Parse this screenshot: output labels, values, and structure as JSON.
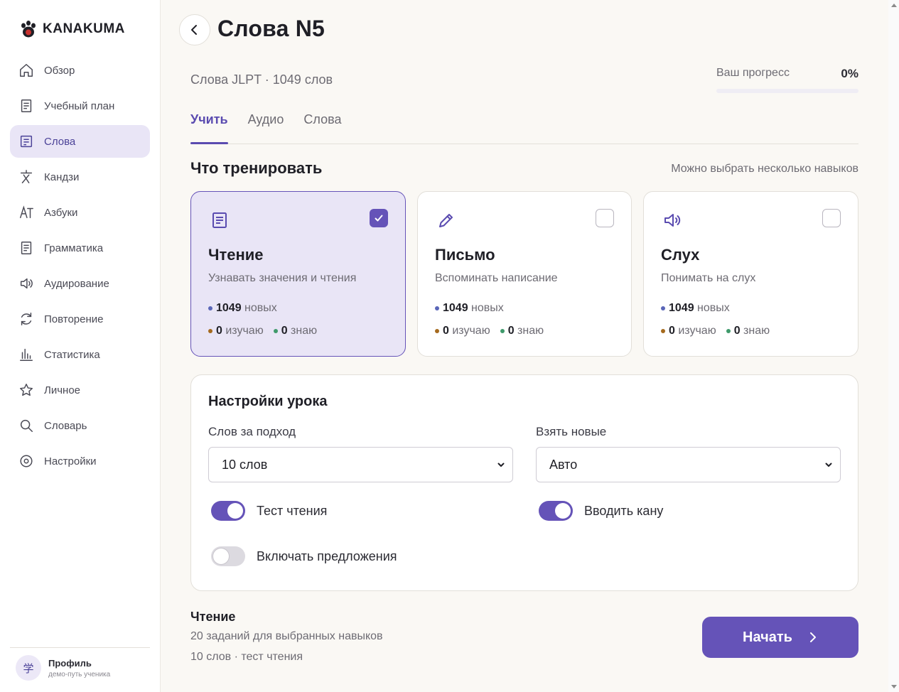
{
  "brand": {
    "name": "KANAKUMA",
    "logo_icon": "paw-icon"
  },
  "sidebar": {
    "items": [
      {
        "label": "Обзор",
        "icon": "home-icon"
      },
      {
        "label": "Учебный план",
        "icon": "document-icon"
      },
      {
        "label": "Слова",
        "icon": "document-icon",
        "active": true
      },
      {
        "label": "Кандзи",
        "icon": "kanji-icon"
      },
      {
        "label": "Азбуки",
        "icon": "kana-icon"
      },
      {
        "label": "Грамматика",
        "icon": "document-icon"
      },
      {
        "label": "Аудирование",
        "icon": "speaker-icon"
      },
      {
        "label": "Повторение",
        "icon": "refresh-icon"
      },
      {
        "label": "Статистика",
        "icon": "bar-chart-icon"
      },
      {
        "label": "Личное",
        "icon": "star-icon"
      },
      {
        "label": "Словарь",
        "icon": "search-icon"
      },
      {
        "label": "Настройки",
        "icon": "gear-icon"
      }
    ]
  },
  "profile": {
    "avatar": "学",
    "name": "Профиль",
    "subtitle": "демо-путь ученика"
  },
  "header": {
    "title": "Слова N5",
    "subtitle": "Слова JLPT · 1049 слов",
    "progress_label": "Ваш прогресс",
    "progress_value": "0%",
    "progress_fraction": 0
  },
  "tabs": [
    {
      "label": "Учить",
      "active": true
    },
    {
      "label": "Аудио"
    },
    {
      "label": "Слова"
    }
  ],
  "train": {
    "title": "Что тренировать",
    "hint": "Можно выбрать несколько навыков",
    "skills": [
      {
        "name": "Чтение",
        "desc": "Узнавать значения и чтения",
        "icon": "document-icon",
        "selected": true,
        "new_count": "1049",
        "new_label": "новых",
        "learning_count": "0",
        "learning_label": "изучаю",
        "known_count": "0",
        "known_label": "знаю"
      },
      {
        "name": "Письмо",
        "desc": "Вспоминать написание",
        "icon": "pencil-icon",
        "selected": false,
        "new_count": "1049",
        "new_label": "новых",
        "learning_count": "0",
        "learning_label": "изучаю",
        "known_count": "0",
        "known_label": "знаю"
      },
      {
        "name": "Слух",
        "desc": "Понимать на слух",
        "icon": "speaker-icon",
        "selected": false,
        "new_count": "1049",
        "new_label": "новых",
        "learning_count": "0",
        "learning_label": "изучаю",
        "known_count": "0",
        "known_label": "знаю"
      }
    ]
  },
  "settings": {
    "title": "Настройки урока",
    "words_label": "Слов за подход",
    "words_value": "10 слов",
    "new_label": "Взять новые",
    "new_value": "Авто",
    "toggles": [
      {
        "label": "Тест чтения",
        "on": true
      },
      {
        "label": "Вводить кану",
        "on": true
      },
      {
        "label": "Включать предложения",
        "on": false
      }
    ]
  },
  "summary": {
    "title": "Чтение",
    "line1": "20 заданий для выбранных навыков",
    "line2": "10 слов · тест чтения"
  },
  "start_button": {
    "label": "Начать"
  },
  "colors": {
    "accent": "#6553b8",
    "new_dot": "#5a66b8",
    "learning_dot": "#a56a1e",
    "known_dot": "#3f9a6b"
  }
}
